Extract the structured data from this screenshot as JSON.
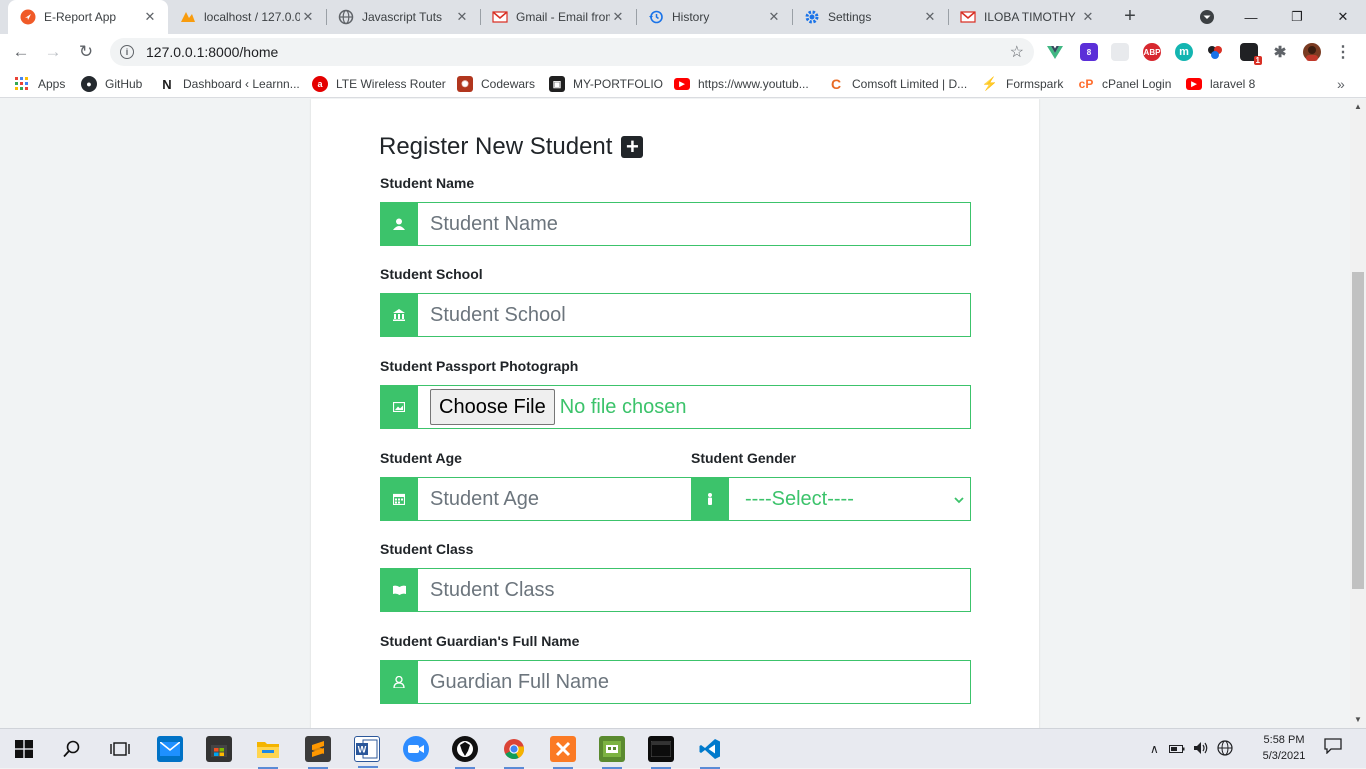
{
  "browser": {
    "tabs": [
      {
        "title": "E-Report App",
        "icon": "e-report-icon",
        "color": "#f05a28",
        "active": true
      },
      {
        "title": "localhost / 127.0.0",
        "icon": "phpmyadmin-icon",
        "color": "#f89c0e"
      },
      {
        "title": "Javascript Tuts",
        "icon": "globe-icon",
        "color": "#5f6368"
      },
      {
        "title": "Gmail - Email from",
        "icon": "gmail-icon",
        "color": "#d93025"
      },
      {
        "title": "History",
        "icon": "history-icon",
        "color": "#1a73e8"
      },
      {
        "title": "Settings",
        "icon": "gear-icon",
        "color": "#1a73e8"
      },
      {
        "title": "ILOBA TIMOTHY",
        "icon": "gmail-icon",
        "color": "#d93025"
      }
    ],
    "url": "127.0.0.1:8000/home",
    "extensions": [
      {
        "icon": "vue-devtools-icon",
        "label": "V",
        "color": "#41b883"
      },
      {
        "icon": "extension-8-icon",
        "label": "8",
        "color": "#5b2fd8"
      },
      {
        "icon": "extension-blank-icon",
        "label": "",
        "color": "#e0e0e0"
      },
      {
        "icon": "adblock-plus-icon",
        "label": "ABP",
        "color": "#d7282f"
      },
      {
        "icon": "m-extension-icon",
        "label": "m",
        "color": "#13b5b1"
      },
      {
        "icon": "circles-extension-icon",
        "label": "●",
        "color": "#202124"
      },
      {
        "icon": "extension-1-icon",
        "label": "1",
        "color": "#202124"
      },
      {
        "icon": "puzzle-icon",
        "label": "✱",
        "color": "#5f6368"
      }
    ],
    "bookmarks": [
      {
        "label": "Apps",
        "icon": "apps-grid-icon",
        "color": "#ea4335"
      },
      {
        "label": "GitHub",
        "icon": "github-icon",
        "color": "#24292e"
      },
      {
        "label": "Dashboard ‹ Learnn...",
        "icon": "learnn-icon",
        "color": "#1d1d1d"
      },
      {
        "label": "LTE Wireless Router",
        "icon": "airtel-icon",
        "color": "#e40000"
      },
      {
        "label": "Codewars",
        "icon": "codewars-icon",
        "color": "#b1361e"
      },
      {
        "label": "MY-PORTFOLIO",
        "icon": "portfolio-icon",
        "color": "#202020"
      },
      {
        "label": "https://www.youtub...",
        "icon": "youtube-icon",
        "color": "#ff0000"
      },
      {
        "label": "Comsoft Limited | D...",
        "icon": "comsoft-icon",
        "color": "#e86a24"
      },
      {
        "label": "Formspark",
        "icon": "formspark-icon",
        "color": "#6b5cf5"
      },
      {
        "label": "cPanel Login",
        "icon": "cpanel-icon",
        "color": "#ff6c2c"
      },
      {
        "label": "laravel 8",
        "icon": "youtube-icon",
        "color": "#ff0000"
      }
    ]
  },
  "form": {
    "title": "Register New Student",
    "fields": {
      "name": {
        "label": "Student Name",
        "placeholder": "Student Name",
        "icon": "user-icon"
      },
      "school": {
        "label": "Student School",
        "placeholder": "Student School",
        "icon": "bank-icon"
      },
      "passport": {
        "label": "Student Passport Photograph",
        "button": "Choose File",
        "status": "No file chosen",
        "icon": "image-icon"
      },
      "age": {
        "label": "Student Age",
        "placeholder": "Student Age",
        "icon": "calendar-icon"
      },
      "gender": {
        "label": "Student Gender",
        "selected": "----Select----",
        "icon": "person-icon"
      },
      "class": {
        "label": "Student Class",
        "placeholder": "Student Class",
        "icon": "book-icon"
      },
      "guardian": {
        "label": "Student Guardian's Full Name",
        "placeholder": "Guardian Full Name",
        "icon": "guardian-icon"
      }
    },
    "accent": "#3cc36b"
  },
  "taskbar": {
    "apps": [
      {
        "icon": "windows-start-icon",
        "color": "#0a0a0a"
      },
      {
        "icon": "search-icon",
        "color": "#0a0a0a"
      },
      {
        "icon": "task-view-icon",
        "color": "#0a0a0a"
      },
      {
        "icon": "mail-icon",
        "color": "#0072c6"
      },
      {
        "icon": "store-icon",
        "color": "#333333"
      },
      {
        "icon": "file-explorer-icon",
        "color": "#f4b400"
      },
      {
        "icon": "sublime-icon",
        "color": "#ff9800"
      },
      {
        "icon": "word-icon",
        "color": "#2b579a"
      },
      {
        "icon": "zoom-icon",
        "color": "#2d8cff"
      },
      {
        "icon": "inkscape-icon",
        "color": "#000000"
      },
      {
        "icon": "chrome-icon",
        "color": "#4285f4"
      },
      {
        "icon": "xampp-icon",
        "color": "#fb7a24"
      },
      {
        "icon": "minecraft-icon",
        "color": "#5a8a2f"
      },
      {
        "icon": "terminal-icon",
        "color": "#0c0c0c"
      },
      {
        "icon": "vscode-icon",
        "color": "#007acc"
      }
    ],
    "time": "5:58 PM",
    "date": "5/3/2021"
  }
}
